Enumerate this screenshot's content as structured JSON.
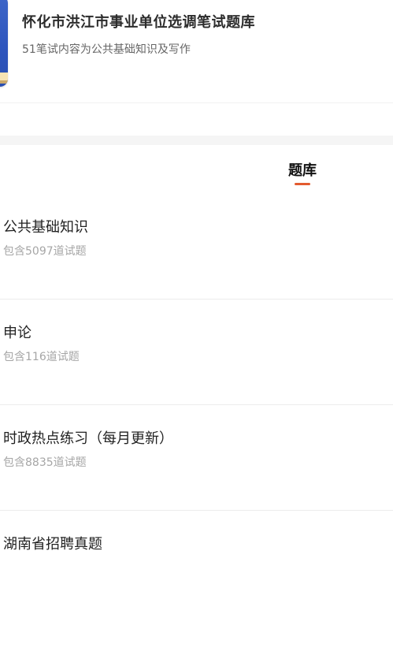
{
  "header": {
    "title": "怀化市洪江市事业单位选调笔试题库",
    "subtitle": "51笔试内容为公共基础知识及写作",
    "cover_icon": "book-cover-icon"
  },
  "tabs": {
    "active_label": "题库",
    "accent_color": "#e35b2f"
  },
  "list": {
    "items": [
      {
        "title": "公共基础知识",
        "subtitle": "包含5097道试题"
      },
      {
        "title": "申论",
        "subtitle": "包含116道试题"
      },
      {
        "title": "时政热点练习（每月更新）",
        "subtitle": "包含8835道试题"
      },
      {
        "title": "湖南省招聘真题",
        "subtitle": ""
      }
    ]
  }
}
